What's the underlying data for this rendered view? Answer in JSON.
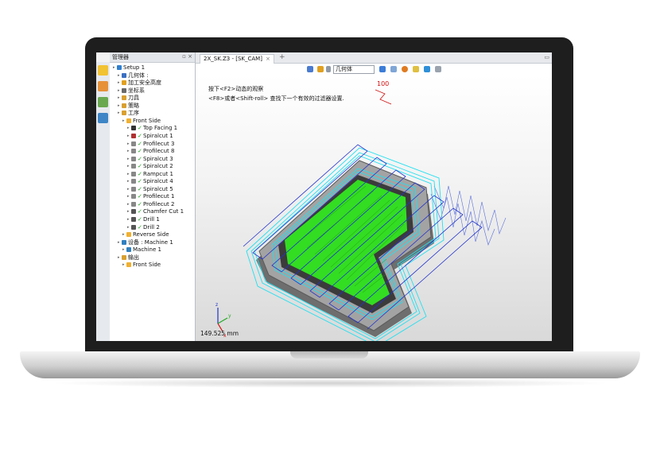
{
  "manager": {
    "title": "管理器",
    "controls": "▫ ×"
  },
  "tree": {
    "items": [
      {
        "label": "Setup 1",
        "icon": "setup-icon",
        "color": "#2f7fd0"
      },
      {
        "label": "几何体 :",
        "icon": "geometry-icon",
        "color": "#3b6fc2"
      },
      {
        "label": "加工安全高度",
        "icon": "safe-height-icon",
        "color": "#e0a020"
      },
      {
        "label": "坐标系",
        "icon": "coordinate-icon",
        "color": "#6a6a6a"
      },
      {
        "label": "刀具",
        "icon": "tool-icon",
        "color": "#d8a030"
      },
      {
        "label": "策略",
        "icon": "strategy-icon",
        "color": "#d8a030"
      },
      {
        "label": "工序",
        "icon": "operations-icon",
        "color": "#d8a030"
      },
      {
        "label": "Front Side",
        "icon": "folder-icon",
        "color": "#f0b030"
      },
      {
        "label": "Top Facing 1",
        "icon": "facing-icon",
        "color": "#333333",
        "checked": true
      },
      {
        "label": "Spiralcut 1",
        "icon": "spiral-icon",
        "color": "#b03030",
        "checked": true
      },
      {
        "label": "Profilecut 3",
        "icon": "profile-icon",
        "color": "#888888",
        "checked": true
      },
      {
        "label": "Profilecut 8",
        "icon": "profile-icon",
        "color": "#888888",
        "checked": true
      },
      {
        "label": "Spiralcut 3",
        "icon": "spiral-icon",
        "color": "#888888",
        "checked": true
      },
      {
        "label": "Spiralcut 2",
        "icon": "spiral-icon",
        "color": "#888888",
        "checked": true
      },
      {
        "label": "Rampcut 1",
        "icon": "ramp-icon",
        "color": "#888888",
        "checked": true
      },
      {
        "label": "Spiralcut 4",
        "icon": "spiral-icon",
        "color": "#888888",
        "checked": true
      },
      {
        "label": "Spiralcut 5",
        "icon": "spiral-icon",
        "color": "#888888",
        "checked": true
      },
      {
        "label": "Profilecut 1",
        "icon": "profile-icon",
        "color": "#888888",
        "checked": true
      },
      {
        "label": "Profilecut 2",
        "icon": "profile-icon",
        "color": "#888888",
        "checked": true
      },
      {
        "label": "Chamfer Cut 1",
        "icon": "chamfer-icon",
        "color": "#555555",
        "checked": true
      },
      {
        "label": "Drill 1",
        "icon": "drill-icon",
        "color": "#555555",
        "checked": true
      },
      {
        "label": "Drill 2",
        "icon": "drill-icon",
        "color": "#555555",
        "checked": true
      },
      {
        "label": "Reverse Side",
        "icon": "folder-icon",
        "color": "#f0b030"
      },
      {
        "label": "设备 : Machine 1",
        "icon": "machine-icon",
        "color": "#3080c0"
      },
      {
        "label": "Machine 1",
        "icon": "machine-icon",
        "color": "#3080c0"
      },
      {
        "label": "输出",
        "icon": "output-icon",
        "color": "#d8a030"
      },
      {
        "label": "Front Side",
        "icon": "folder-icon",
        "color": "#f0b030"
      }
    ]
  },
  "document": {
    "tab_label": "2X_SK.Z3 - [SK_CAM]",
    "tab_close": "×",
    "tab_add": "+",
    "tab_menu": "▭",
    "filter_select": "几何体",
    "hint_line1": "按下<F2>动态的观察",
    "hint_line2": "<F8>或者<Shift-roll> 查找下一个有效的过滤器设置.",
    "annotation": "100",
    "measurement": "149.525 mm"
  },
  "colors": {
    "toolpath_blue": "#2233cc",
    "toolpath_cyan": "#22e0f0",
    "pocket_green": "#33dd22",
    "part_gray": "#8a8a8a",
    "accent_red": "#d01010"
  }
}
